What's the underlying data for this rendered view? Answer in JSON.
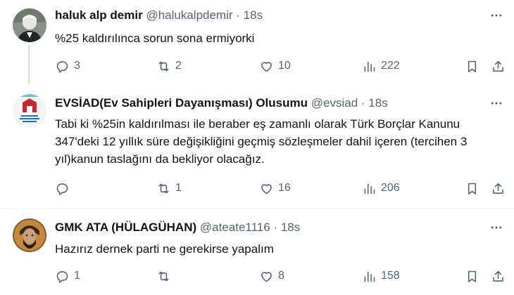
{
  "tweets": [
    {
      "name": "haluk alp demir",
      "handle": "@halukalpdemir",
      "separator": "·",
      "time": "18s",
      "text": "%25 kaldırılınca sorun sona ermiyorki",
      "replies": "3",
      "retweets": "2",
      "likes": "10",
      "views": "222"
    },
    {
      "name": "EVSİAD(Ev Sahipleri Dayanışması) Olusumu",
      "handle": "@evsiad",
      "separator": "·",
      "time": "18s",
      "text": "Tabi ki %25in kaldırılması ile beraber eş zamanlı olarak Türk Borçlar Kanunu 347'deki 12 yıllık süre değişikliğini geçmiş sözleşmeler dahil içeren (tercihen 3 yıl)kanun taslağını da bekliyor olacağız.",
      "replies": "",
      "retweets": "1",
      "likes": "16",
      "views": "206"
    },
    {
      "name": "GMK ATA (HÜLAGÜHAN)",
      "handle": "@ateate1116",
      "separator": "·",
      "time": "18s",
      "text": "Hazırız dernek parti ne gerekirse yapalım",
      "replies": "1",
      "retweets": "",
      "likes": "8",
      "views": "158"
    }
  ],
  "colors": {
    "text_primary": "#0f1419",
    "text_secondary": "#536471",
    "divider": "#eff3f4",
    "thread_line": "#cfd9de"
  },
  "icons": [
    "reply-icon",
    "retweet-icon",
    "like-icon",
    "views-icon",
    "bookmark-icon",
    "share-icon",
    "more-icon"
  ]
}
